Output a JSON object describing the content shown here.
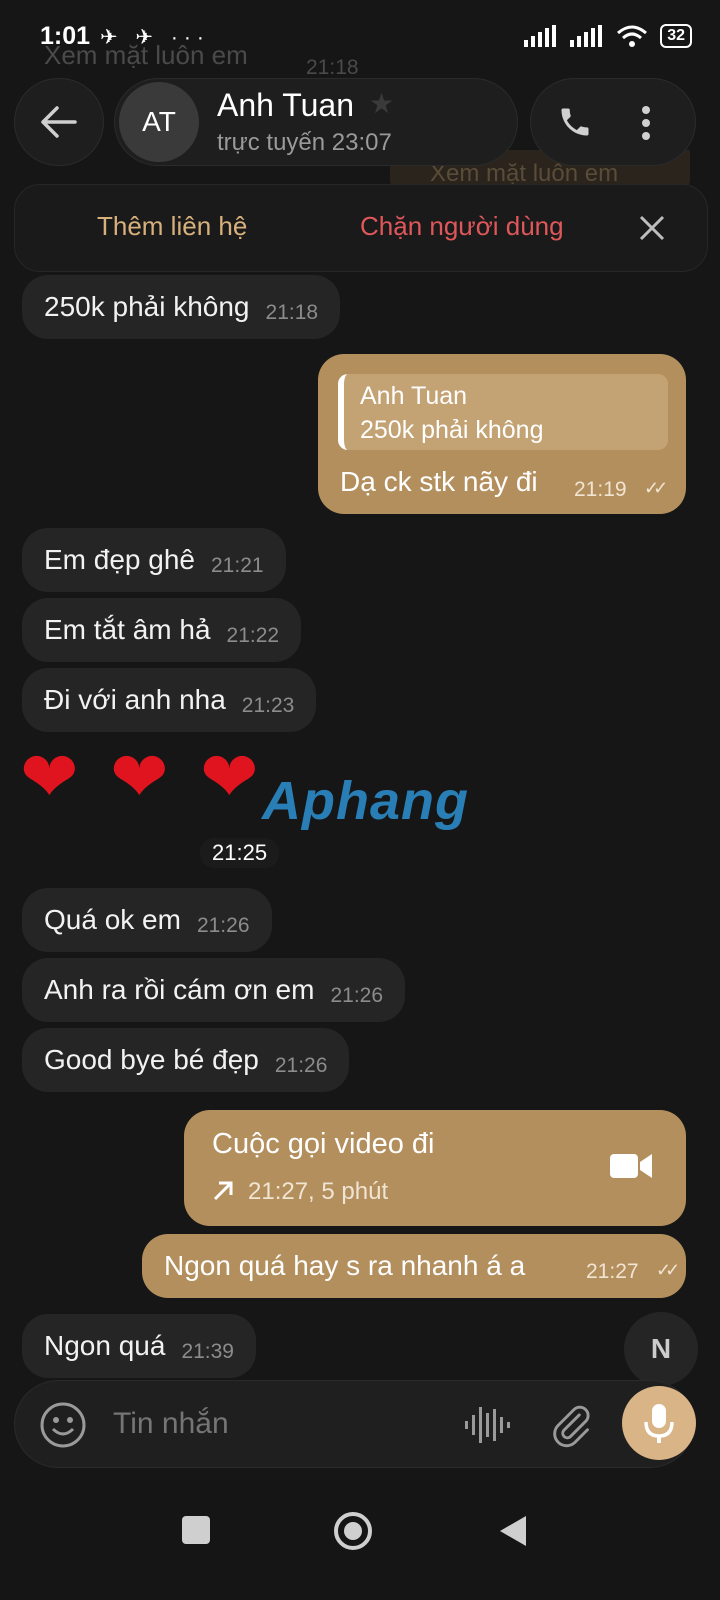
{
  "status_bar": {
    "time": "1:01",
    "notif_icons": "✈ ✈ ···",
    "battery": "32"
  },
  "background": {
    "top_message": "Xem mặt luôn em",
    "top_time": "21:18",
    "behind_header": "Xem mặt luôn em"
  },
  "header": {
    "avatar_initials": "AT",
    "name": "Anh Tuan",
    "status": "trực tuyến 23:07"
  },
  "banner": {
    "add_contact": "Thêm liên hệ",
    "block_user": "Chặn người dùng"
  },
  "messages": [
    {
      "text": "250k phải không",
      "time": "21:18"
    },
    {
      "reply_author": "Anh Tuan",
      "reply_text": "250k phải không",
      "text": "Dạ ck stk nãy đi",
      "time": "21:19"
    },
    {
      "text": "Em đẹp ghê",
      "time": "21:21"
    },
    {
      "text": "Em tắt âm hả",
      "time": "21:22"
    },
    {
      "text": "Đi với anh nha",
      "time": "21:23"
    },
    {
      "emoji": "❤❤❤",
      "time": "21:25"
    },
    {
      "text": "Quá ok em",
      "time": "21:26"
    },
    {
      "text": "Anh ra rồi cám ơn em",
      "time": "21:26"
    },
    {
      "text": "Good bye bé đẹp",
      "time": "21:26"
    },
    {
      "call_title": "Cuộc gọi video đi",
      "call_detail": "21:27, 5 phút"
    },
    {
      "text": "Ngon quá hay s ra nhanh á a",
      "time": "21:27"
    },
    {
      "text": "Ngon quá",
      "time": "21:39"
    }
  ],
  "watermark": "Aphang",
  "composer": {
    "placeholder": "Tin nhắn"
  },
  "colors": {
    "accent": "#b48f5e",
    "block_red": "#e0575a",
    "add_gold": "#d8b07c",
    "bg": "#161616"
  }
}
